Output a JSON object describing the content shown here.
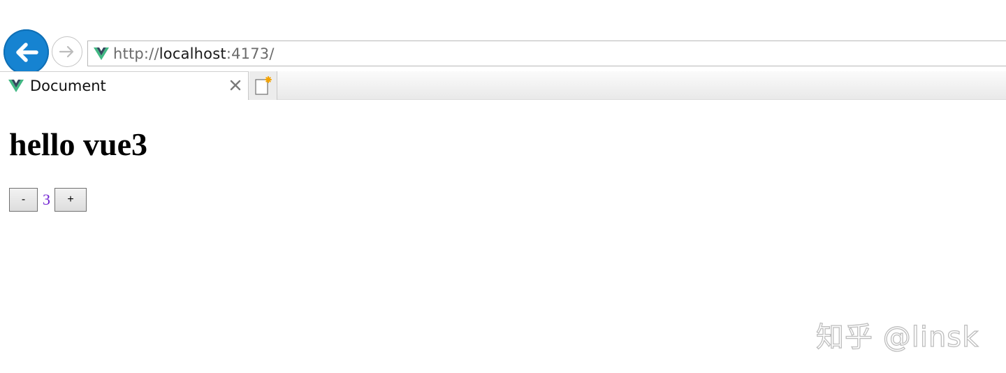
{
  "browser": {
    "address": {
      "scheme": "http://",
      "host": "localhost",
      "port_path": ":4173/"
    },
    "tab": {
      "title": "Document",
      "close_symbol": "×"
    },
    "icons": {
      "back": "arrow-left-icon",
      "forward": "arrow-right-icon",
      "site": "vue-logo-icon",
      "new_tab": "new-tab-icon"
    },
    "colors": {
      "back_button": "#1683d1",
      "vue_green": "#41b883",
      "vue_dark": "#34495e"
    }
  },
  "page": {
    "heading": "hello vue3",
    "counter": {
      "decrement_label": "-",
      "value": "3",
      "increment_label": "+"
    },
    "value_color": "#6f1fd1"
  },
  "watermark": "知乎 @linsk"
}
